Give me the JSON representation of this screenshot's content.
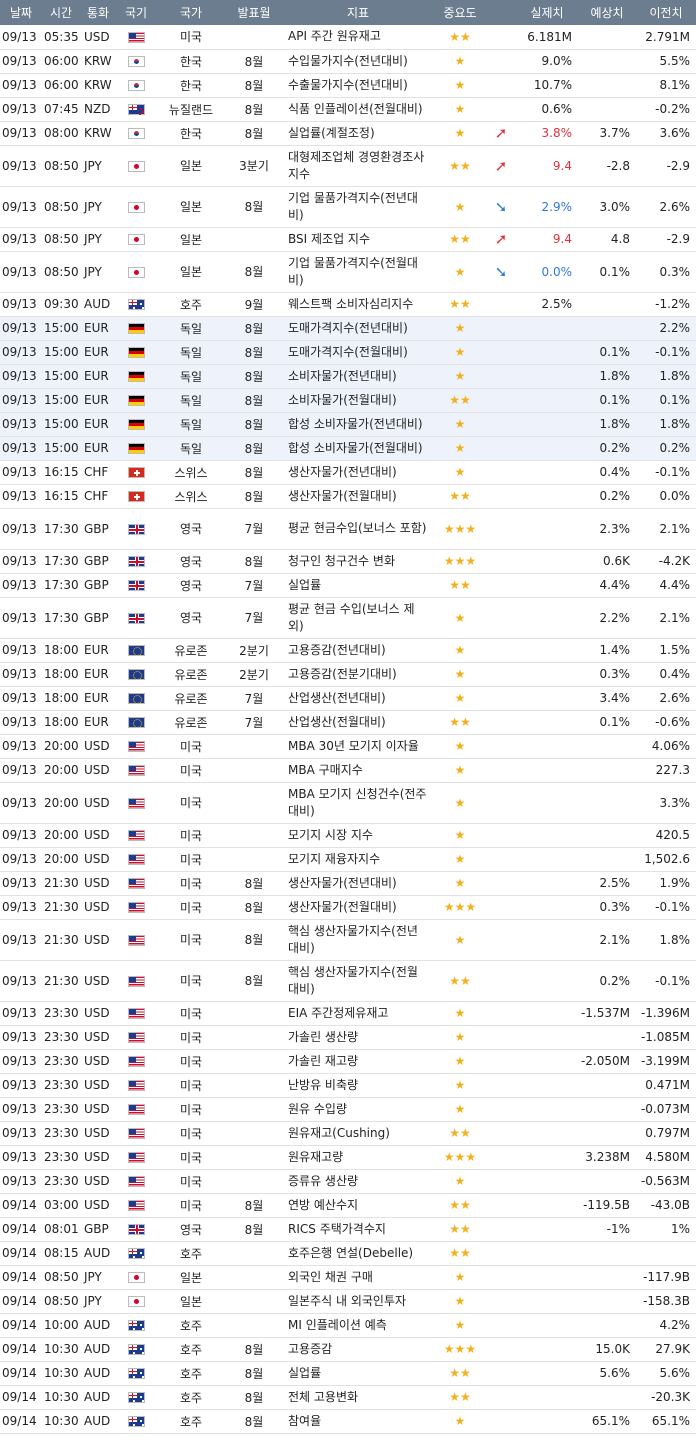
{
  "header": [
    "날짜",
    "시간",
    "통화",
    "국기",
    "국가",
    "발표월",
    "지표",
    "중요도",
    "",
    "실제치",
    "예상치",
    "이전치"
  ],
  "rows": [
    {
      "date": "09/13",
      "time": "05:35",
      "cur": "USD",
      "flag": "us",
      "country": "미국",
      "period": "",
      "name": "API 주간 원유재고",
      "stars": "★★",
      "arrow": "",
      "actual": "6.181M",
      "forecast": "",
      "previous": "2.791M",
      "h": 24
    },
    {
      "date": "09/13",
      "time": "06:00",
      "cur": "KRW",
      "flag": "kr",
      "country": "한국",
      "period": "8월",
      "name": "수입물가지수(전년대비)",
      "stars": "★",
      "arrow": "",
      "actual": "9.0%",
      "forecast": "",
      "previous": "5.5%",
      "h": 24
    },
    {
      "date": "09/13",
      "time": "06:00",
      "cur": "KRW",
      "flag": "kr",
      "country": "한국",
      "period": "8월",
      "name": "수출물가지수(전년대비)",
      "stars": "★",
      "arrow": "",
      "actual": "10.7%",
      "forecast": "",
      "previous": "8.1%",
      "h": 24
    },
    {
      "date": "09/13",
      "time": "07:45",
      "cur": "NZD",
      "flag": "nz",
      "country": "뉴질랜드",
      "period": "8월",
      "name": "식품 인플레이션(전월대비)",
      "stars": "★",
      "arrow": "",
      "actual": "0.6%",
      "forecast": "",
      "previous": "-0.2%",
      "h": 24
    },
    {
      "date": "09/13",
      "time": "08:00",
      "cur": "KRW",
      "flag": "kr",
      "country": "한국",
      "period": "8월",
      "name": "실업률(계절조정)",
      "stars": "★",
      "arrow": "up",
      "actual": "3.8%",
      "forecast": "3.7%",
      "previous": "3.6%",
      "h": 24
    },
    {
      "date": "09/13",
      "time": "08:50",
      "cur": "JPY",
      "flag": "jp",
      "country": "일본",
      "period": "3분기",
      "name": "대형제조업체 경영환경조사지수",
      "stars": "★★",
      "arrow": "up",
      "actual": "9.4",
      "forecast": "-2.8",
      "previous": "-2.9",
      "h": 41
    },
    {
      "date": "09/13",
      "time": "08:50",
      "cur": "JPY",
      "flag": "jp",
      "country": "일본",
      "period": "8월",
      "name": "기업 물품가격지수(전년대비)",
      "stars": "★",
      "arrow": "dn",
      "actual": "2.9%",
      "forecast": "3.0%",
      "previous": "2.6%",
      "h": 41
    },
    {
      "date": "09/13",
      "time": "08:50",
      "cur": "JPY",
      "flag": "jp",
      "country": "일본",
      "period": "",
      "name": "BSI 제조업 지수",
      "stars": "★★",
      "arrow": "up",
      "actual": "9.4",
      "forecast": "4.8",
      "previous": "-2.9",
      "h": 24
    },
    {
      "date": "09/13",
      "time": "08:50",
      "cur": "JPY",
      "flag": "jp",
      "country": "일본",
      "period": "8월",
      "name": "기업 물품가격지수(전월대비)",
      "stars": "★",
      "arrow": "dn",
      "actual": "0.0%",
      "forecast": "0.1%",
      "previous": "0.3%",
      "h": 41
    },
    {
      "date": "09/13",
      "time": "09:30",
      "cur": "AUD",
      "flag": "au",
      "country": "호주",
      "period": "9월",
      "name": "웨스트팩 소비자심리지수",
      "stars": "★★",
      "arrow": "",
      "actual": "2.5%",
      "forecast": "",
      "previous": "-1.2%",
      "h": 24
    },
    {
      "date": "09/13",
      "time": "15:00",
      "cur": "EUR",
      "flag": "de",
      "country": "독일",
      "period": "8월",
      "name": "도매가격지수(전년대비)",
      "stars": "★",
      "arrow": "",
      "actual": "",
      "forecast": "",
      "previous": "2.2%",
      "h": 24,
      "hl": true
    },
    {
      "date": "09/13",
      "time": "15:00",
      "cur": "EUR",
      "flag": "de",
      "country": "독일",
      "period": "8월",
      "name": "도매가격지수(전월대비)",
      "stars": "★",
      "arrow": "",
      "actual": "",
      "forecast": "0.1%",
      "previous": "-0.1%",
      "h": 24,
      "hl": true
    },
    {
      "date": "09/13",
      "time": "15:00",
      "cur": "EUR",
      "flag": "de",
      "country": "독일",
      "period": "8월",
      "name": "소비자물가(전년대비)",
      "stars": "★",
      "arrow": "",
      "actual": "",
      "forecast": "1.8%",
      "previous": "1.8%",
      "h": 24,
      "hl": true
    },
    {
      "date": "09/13",
      "time": "15:00",
      "cur": "EUR",
      "flag": "de",
      "country": "독일",
      "period": "8월",
      "name": "소비자물가(전월대비)",
      "stars": "★★",
      "arrow": "",
      "actual": "",
      "forecast": "0.1%",
      "previous": "0.1%",
      "h": 24,
      "hl": true
    },
    {
      "date": "09/13",
      "time": "15:00",
      "cur": "EUR",
      "flag": "de",
      "country": "독일",
      "period": "8월",
      "name": "합성 소비자물가(전년대비)",
      "stars": "★",
      "arrow": "",
      "actual": "",
      "forecast": "1.8%",
      "previous": "1.8%",
      "h": 24,
      "hl": true
    },
    {
      "date": "09/13",
      "time": "15:00",
      "cur": "EUR",
      "flag": "de",
      "country": "독일",
      "period": "8월",
      "name": "합성 소비자물가(전월대비)",
      "stars": "★",
      "arrow": "",
      "actual": "",
      "forecast": "0.2%",
      "previous": "0.2%",
      "h": 24,
      "hl": true
    },
    {
      "date": "09/13",
      "time": "16:15",
      "cur": "CHF",
      "flag": "ch",
      "country": "스위스",
      "period": "8월",
      "name": "생산자물가(전년대비)",
      "stars": "★",
      "arrow": "",
      "actual": "",
      "forecast": "0.4%",
      "previous": "-0.1%",
      "h": 24
    },
    {
      "date": "09/13",
      "time": "16:15",
      "cur": "CHF",
      "flag": "ch",
      "country": "스위스",
      "period": "8월",
      "name": "생산자물가(전월대비)",
      "stars": "★★",
      "arrow": "",
      "actual": "",
      "forecast": "0.2%",
      "previous": "0.0%",
      "h": 24
    },
    {
      "date": "09/13",
      "time": "17:30",
      "cur": "GBP",
      "flag": "gb",
      "country": "영국",
      "period": "7월",
      "name": "평균 현금수입(보너스 포함)",
      "stars": "★★★",
      "arrow": "",
      "actual": "",
      "forecast": "2.3%",
      "previous": "2.1%",
      "h": 41
    },
    {
      "date": "09/13",
      "time": "17:30",
      "cur": "GBP",
      "flag": "gb",
      "country": "영국",
      "period": "8월",
      "name": "청구인 청구건수 변화",
      "stars": "★★★",
      "arrow": "",
      "actual": "",
      "forecast": "0.6K",
      "previous": "-4.2K",
      "h": 24
    },
    {
      "date": "09/13",
      "time": "17:30",
      "cur": "GBP",
      "flag": "gb",
      "country": "영국",
      "period": "7월",
      "name": "실업률",
      "stars": "★★",
      "arrow": "",
      "actual": "",
      "forecast": "4.4%",
      "previous": "4.4%",
      "h": 24
    },
    {
      "date": "09/13",
      "time": "17:30",
      "cur": "GBP",
      "flag": "gb",
      "country": "영국",
      "period": "7월",
      "name": "평균 현금 수입(보너스 제외)",
      "stars": "★",
      "arrow": "",
      "actual": "",
      "forecast": "2.2%",
      "previous": "2.1%",
      "h": 41
    },
    {
      "date": "09/13",
      "time": "18:00",
      "cur": "EUR",
      "flag": "eu",
      "country": "유로존",
      "period": "2분기",
      "name": "고용증감(전년대비)",
      "stars": "★",
      "arrow": "",
      "actual": "",
      "forecast": "1.4%",
      "previous": "1.5%",
      "h": 24
    },
    {
      "date": "09/13",
      "time": "18:00",
      "cur": "EUR",
      "flag": "eu",
      "country": "유로존",
      "period": "2분기",
      "name": "고용증감(전분기대비)",
      "stars": "★",
      "arrow": "",
      "actual": "",
      "forecast": "0.3%",
      "previous": "0.4%",
      "h": 24
    },
    {
      "date": "09/13",
      "time": "18:00",
      "cur": "EUR",
      "flag": "eu",
      "country": "유로존",
      "period": "7월",
      "name": "산업생산(전년대비)",
      "stars": "★",
      "arrow": "",
      "actual": "",
      "forecast": "3.4%",
      "previous": "2.6%",
      "h": 24
    },
    {
      "date": "09/13",
      "time": "18:00",
      "cur": "EUR",
      "flag": "eu",
      "country": "유로존",
      "period": "7월",
      "name": "산업생산(전월대비)",
      "stars": "★★",
      "arrow": "",
      "actual": "",
      "forecast": "0.1%",
      "previous": "-0.6%",
      "h": 24
    },
    {
      "date": "09/13",
      "time": "20:00",
      "cur": "USD",
      "flag": "us",
      "country": "미국",
      "period": "",
      "name": "MBA 30년 모기지 이자율",
      "stars": "★",
      "arrow": "",
      "actual": "",
      "forecast": "",
      "previous": "4.06%",
      "h": 24
    },
    {
      "date": "09/13",
      "time": "20:00",
      "cur": "USD",
      "flag": "us",
      "country": "미국",
      "period": "",
      "name": "MBA 구매지수",
      "stars": "★",
      "arrow": "",
      "actual": "",
      "forecast": "",
      "previous": "227.3",
      "h": 24
    },
    {
      "date": "09/13",
      "time": "20:00",
      "cur": "USD",
      "flag": "us",
      "country": "미국",
      "period": "",
      "name": "MBA 모기지 신청건수(전주대비)",
      "stars": "★",
      "arrow": "",
      "actual": "",
      "forecast": "",
      "previous": "3.3%",
      "h": 41
    },
    {
      "date": "09/13",
      "time": "20:00",
      "cur": "USD",
      "flag": "us",
      "country": "미국",
      "period": "",
      "name": "모기지 시장 지수",
      "stars": "★",
      "arrow": "",
      "actual": "",
      "forecast": "",
      "previous": "420.5",
      "h": 24
    },
    {
      "date": "09/13",
      "time": "20:00",
      "cur": "USD",
      "flag": "us",
      "country": "미국",
      "period": "",
      "name": "모기지 재융자지수",
      "stars": "★",
      "arrow": "",
      "actual": "",
      "forecast": "",
      "previous": "1,502.6",
      "h": 24
    },
    {
      "date": "09/13",
      "time": "21:30",
      "cur": "USD",
      "flag": "us",
      "country": "미국",
      "period": "8월",
      "name": "생산자물가(전년대비)",
      "stars": "★",
      "arrow": "",
      "actual": "",
      "forecast": "2.5%",
      "previous": "1.9%",
      "h": 24
    },
    {
      "date": "09/13",
      "time": "21:30",
      "cur": "USD",
      "flag": "us",
      "country": "미국",
      "period": "8월",
      "name": "생산자물가(전월대비)",
      "stars": "★★★",
      "arrow": "",
      "actual": "",
      "forecast": "0.3%",
      "previous": "-0.1%",
      "h": 24
    },
    {
      "date": "09/13",
      "time": "21:30",
      "cur": "USD",
      "flag": "us",
      "country": "미국",
      "period": "8월",
      "name": "핵심 생산자물가지수(전년대비)",
      "stars": "★",
      "arrow": "",
      "actual": "",
      "forecast": "2.1%",
      "previous": "1.8%",
      "h": 41
    },
    {
      "date": "09/13",
      "time": "21:30",
      "cur": "USD",
      "flag": "us",
      "country": "미국",
      "period": "8월",
      "name": "핵심 생산자물가지수(전월대비)",
      "stars": "★★",
      "arrow": "",
      "actual": "",
      "forecast": "0.2%",
      "previous": "-0.1%",
      "h": 41
    },
    {
      "date": "09/13",
      "time": "23:30",
      "cur": "USD",
      "flag": "us",
      "country": "미국",
      "period": "",
      "name": "EIA 주간정제유재고",
      "stars": "★",
      "arrow": "",
      "actual": "",
      "forecast": "-1.537M",
      "previous": "-1.396M",
      "h": 24
    },
    {
      "date": "09/13",
      "time": "23:30",
      "cur": "USD",
      "flag": "us",
      "country": "미국",
      "period": "",
      "name": "가솔린 생산량",
      "stars": "★",
      "arrow": "",
      "actual": "",
      "forecast": "",
      "previous": "-1.085M",
      "h": 24
    },
    {
      "date": "09/13",
      "time": "23:30",
      "cur": "USD",
      "flag": "us",
      "country": "미국",
      "period": "",
      "name": "가솔린 재고량",
      "stars": "★",
      "arrow": "",
      "actual": "",
      "forecast": "-2.050M",
      "previous": "-3.199M",
      "h": 24
    },
    {
      "date": "09/13",
      "time": "23:30",
      "cur": "USD",
      "flag": "us",
      "country": "미국",
      "period": "",
      "name": "난방유 비축량",
      "stars": "★",
      "arrow": "",
      "actual": "",
      "forecast": "",
      "previous": "0.471M",
      "h": 24
    },
    {
      "date": "09/13",
      "time": "23:30",
      "cur": "USD",
      "flag": "us",
      "country": "미국",
      "period": "",
      "name": "원유 수입량",
      "stars": "★",
      "arrow": "",
      "actual": "",
      "forecast": "",
      "previous": "-0.073M",
      "h": 24
    },
    {
      "date": "09/13",
      "time": "23:30",
      "cur": "USD",
      "flag": "us",
      "country": "미국",
      "period": "",
      "name": "원유재고(Cushing)",
      "stars": "★★",
      "arrow": "",
      "actual": "",
      "forecast": "",
      "previous": "0.797M",
      "h": 24
    },
    {
      "date": "09/13",
      "time": "23:30",
      "cur": "USD",
      "flag": "us",
      "country": "미국",
      "period": "",
      "name": "원유재고량",
      "stars": "★★★",
      "arrow": "",
      "actual": "",
      "forecast": "3.238M",
      "previous": "4.580M",
      "h": 24
    },
    {
      "date": "09/13",
      "time": "23:30",
      "cur": "USD",
      "flag": "us",
      "country": "미국",
      "period": "",
      "name": "증류유 생산량",
      "stars": "★",
      "arrow": "",
      "actual": "",
      "forecast": "",
      "previous": "-0.563M",
      "h": 24
    },
    {
      "date": "09/14",
      "time": "03:00",
      "cur": "USD",
      "flag": "us",
      "country": "미국",
      "period": "8월",
      "name": "연방 예산수지",
      "stars": "★★",
      "arrow": "",
      "actual": "",
      "forecast": "-119.5B",
      "previous": "-43.0B",
      "h": 24
    },
    {
      "date": "09/14",
      "time": "08:01",
      "cur": "GBP",
      "flag": "gb",
      "country": "영국",
      "period": "8월",
      "name": "RICS 주택가격수지",
      "stars": "★★",
      "arrow": "",
      "actual": "",
      "forecast": "-1%",
      "previous": "1%",
      "h": 24
    },
    {
      "date": "09/14",
      "time": "08:15",
      "cur": "AUD",
      "flag": "au",
      "country": "호주",
      "period": "",
      "name": "호주은행 연설(Debelle)",
      "stars": "★★",
      "arrow": "",
      "actual": "",
      "forecast": "",
      "previous": "",
      "h": 24
    },
    {
      "date": "09/14",
      "time": "08:50",
      "cur": "JPY",
      "flag": "jp",
      "country": "일본",
      "period": "",
      "name": "외국인 채권 구매",
      "stars": "★",
      "arrow": "",
      "actual": "",
      "forecast": "",
      "previous": "-117.9B",
      "h": 24
    },
    {
      "date": "09/14",
      "time": "08:50",
      "cur": "JPY",
      "flag": "jp",
      "country": "일본",
      "period": "",
      "name": "일본주식 내 외국인투자",
      "stars": "★",
      "arrow": "",
      "actual": "",
      "forecast": "",
      "previous": "-158.3B",
      "h": 24
    },
    {
      "date": "09/14",
      "time": "10:00",
      "cur": "AUD",
      "flag": "au",
      "country": "호주",
      "period": "",
      "name": "MI 인플레이션 예측",
      "stars": "★",
      "arrow": "",
      "actual": "",
      "forecast": "",
      "previous": "4.2%",
      "h": 24
    },
    {
      "date": "09/14",
      "time": "10:30",
      "cur": "AUD",
      "flag": "au",
      "country": "호주",
      "period": "8월",
      "name": "고용증감",
      "stars": "★★★",
      "arrow": "",
      "actual": "",
      "forecast": "15.0K",
      "previous": "27.9K",
      "h": 24
    },
    {
      "date": "09/14",
      "time": "10:30",
      "cur": "AUD",
      "flag": "au",
      "country": "호주",
      "period": "8월",
      "name": "실업률",
      "stars": "★★",
      "arrow": "",
      "actual": "",
      "forecast": "5.6%",
      "previous": "5.6%",
      "h": 24
    },
    {
      "date": "09/14",
      "time": "10:30",
      "cur": "AUD",
      "flag": "au",
      "country": "호주",
      "period": "8월",
      "name": "전체 고용변화",
      "stars": "★★",
      "arrow": "",
      "actual": "",
      "forecast": "",
      "previous": "-20.3K",
      "h": 24
    },
    {
      "date": "09/14",
      "time": "10:30",
      "cur": "AUD",
      "flag": "au",
      "country": "호주",
      "period": "8월",
      "name": "참여율",
      "stars": "★",
      "arrow": "",
      "actual": "",
      "forecast": "65.1%",
      "previous": "65.1%",
      "h": 24
    }
  ]
}
